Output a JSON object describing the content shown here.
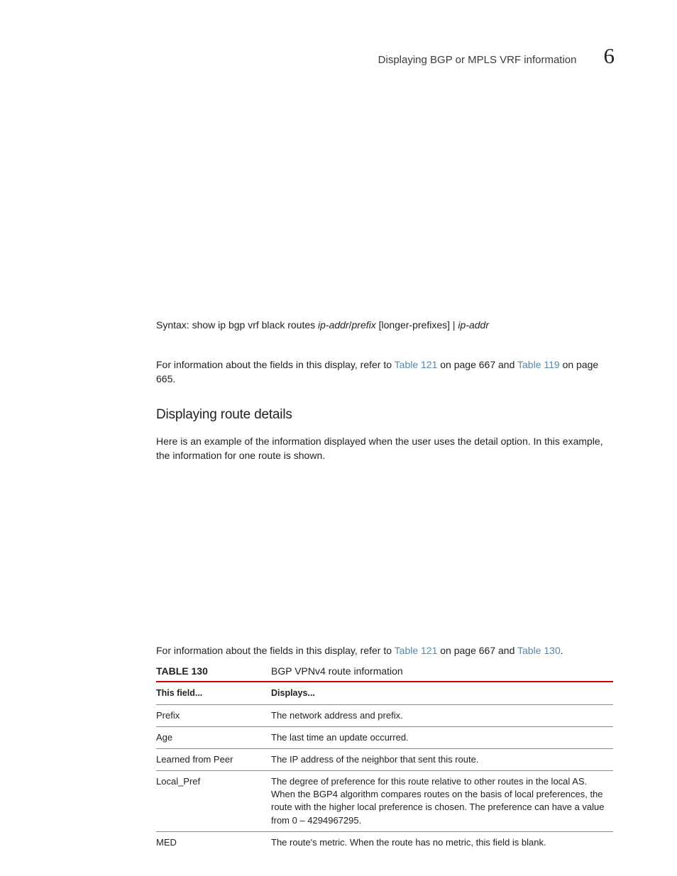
{
  "header": {
    "title": "Displaying BGP or MPLS VRF information",
    "chapter": "6"
  },
  "syntax": {
    "label": "Syntax:",
    "cmd_prefix": " show ip bgp vrf black routes ",
    "arg1": "ip-addr",
    "sep1": "/",
    "arg2": "prefix",
    "opt": " [longer-prefixes] | ",
    "arg3": "ip-addr"
  },
  "para1": {
    "t1": "For information about the fields in this display, refer to ",
    "l1": "Table 121",
    "t2": " on page 667 and ",
    "l2": "Table 119",
    "t3": " on page 665."
  },
  "heading": "Displaying route details",
  "para2": "Here is an example of the information displayed when the user uses the detail option. In this example, the information for one route is shown.",
  "para3": {
    "t1": "For information about the fields in this display, refer to ",
    "l1": "Table 121",
    "t2": " on page 667 and ",
    "l2": "Table 130",
    "t3": "."
  },
  "table": {
    "number": "TABLE 130",
    "caption": "BGP VPNv4 route information",
    "head": {
      "c1": "This field...",
      "c2": "Displays..."
    },
    "rows": [
      {
        "f": "Prefix",
        "d": "The network address and prefix."
      },
      {
        "f": "Age",
        "d": "The last time an update occurred."
      },
      {
        "f": "Learned from Peer",
        "d": "The IP address of the neighbor that sent this route."
      },
      {
        "f": "Local_Pref",
        "d": "The degree of preference for this route relative to other routes in the local AS. When the BGP4 algorithm compares routes on the basis of local preferences, the route with the higher local preference is chosen. The preference can have a value from 0 – 4294967295."
      },
      {
        "f": "MED",
        "d": "The route's metric. When the route has no metric, this field is blank."
      }
    ]
  }
}
